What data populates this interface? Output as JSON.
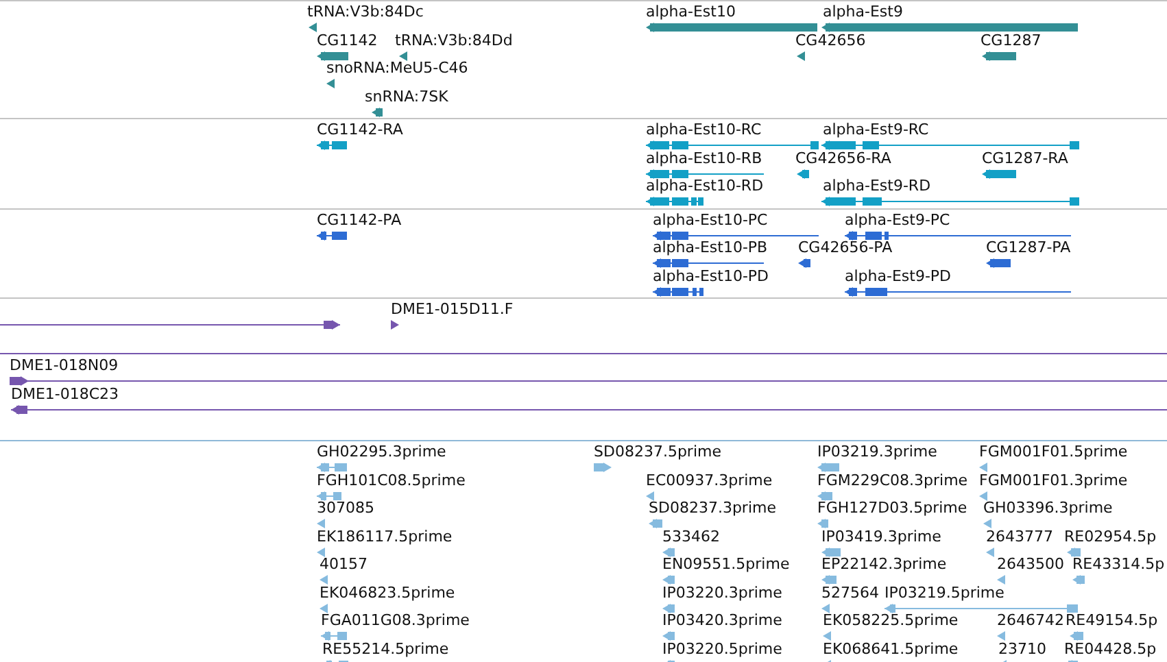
{
  "tracks": [
    {
      "kind": "gene",
      "features": [
        {
          "label": "tRNA:V3b:84Dc",
          "reverse": true
        },
        {
          "label": "CG1142",
          "reverse": true
        },
        {
          "label": "tRNA:V3b:84Dd",
          "reverse": true
        },
        {
          "label": "snoRNA:MeU5-C46",
          "reverse": true
        },
        {
          "label": "snRNA:7SK",
          "reverse": true
        },
        {
          "label": "alpha-Est10",
          "reverse": true
        },
        {
          "label": "alpha-Est9",
          "reverse": true
        },
        {
          "label": "CG42656",
          "reverse": true
        },
        {
          "label": "CG1287",
          "reverse": true
        }
      ]
    },
    {
      "kind": "transcript",
      "features": [
        {
          "label": "CG1142-RA",
          "reverse": true
        },
        {
          "label": "alpha-Est10-RC",
          "reverse": true
        },
        {
          "label": "alpha-Est9-RC",
          "reverse": true
        },
        {
          "label": "alpha-Est10-RB",
          "reverse": true
        },
        {
          "label": "CG42656-RA",
          "reverse": true
        },
        {
          "label": "CG1287-RA",
          "reverse": true
        },
        {
          "label": "alpha-Est10-RD",
          "reverse": true
        },
        {
          "label": "alpha-Est9-RD",
          "reverse": true
        }
      ]
    },
    {
      "kind": "protein",
      "features": [
        {
          "label": "CG1142-PA",
          "reverse": true
        },
        {
          "label": "alpha-Est10-PC",
          "reverse": true
        },
        {
          "label": "alpha-Est9-PC",
          "reverse": true
        },
        {
          "label": "alpha-Est10-PB",
          "reverse": true
        },
        {
          "label": "CG42656-PA",
          "reverse": true
        },
        {
          "label": "CG1287-PA",
          "reverse": true
        },
        {
          "label": "alpha-Est10-PD",
          "reverse": true
        },
        {
          "label": "alpha-Est9-PD",
          "reverse": true
        }
      ]
    },
    {
      "kind": "clone",
      "features": [
        {
          "reverse": false
        },
        {
          "label": "DME1-015D11.F",
          "reverse": false
        },
        {
          "kind": "span"
        },
        {
          "label": "DME1-018N09",
          "reverse": false
        },
        {
          "label": "DME1-018C23",
          "reverse": true
        }
      ]
    },
    {
      "kind": "est",
      "features": [
        {
          "label": "GH02295.3prime",
          "reverse": true
        },
        {
          "label": "SD08237.5prime",
          "reverse": false
        },
        {
          "label": "IP03219.3prime",
          "reverse": true
        },
        {
          "label": "FGM001F01.5prime",
          "reverse": true
        },
        {
          "label": "FGH101C08.5prime",
          "reverse": true
        },
        {
          "label": "EC00937.3prime",
          "reverse": true
        },
        {
          "label": "FGM229C08.3prime",
          "reverse": true
        },
        {
          "label": "FGM001F01.3prime",
          "reverse": true
        },
        {
          "label": "307085",
          "reverse": true
        },
        {
          "label": "SD08237.3prime",
          "reverse": true
        },
        {
          "label": "FGH127D03.5prime",
          "reverse": true
        },
        {
          "label": "GH03396.3prime",
          "reverse": true
        },
        {
          "label": "EK186117.5prime",
          "reverse": true
        },
        {
          "label": "533462",
          "reverse": true
        },
        {
          "label": "IP03419.3prime",
          "reverse": true
        },
        {
          "label": "2643777",
          "reverse": true
        },
        {
          "label": "RE02954.5p",
          "reverse": true
        },
        {
          "label": "40157",
          "reverse": true
        },
        {
          "label": "EN09551.5prime",
          "reverse": true
        },
        {
          "label": "EP22142.3prime",
          "reverse": true
        },
        {
          "label": "2643500",
          "reverse": true
        },
        {
          "label": "RE43314.5p",
          "reverse": true
        },
        {
          "label": "EK046823.5prime",
          "reverse": true
        },
        {
          "label": "IP03220.3prime",
          "reverse": true
        },
        {
          "label": "527564",
          "reverse": true
        },
        {
          "label": "IP03219.5prime",
          "reverse": true
        },
        {
          "label": "FGA011G08.3prime",
          "reverse": true
        },
        {
          "label": "IP03420.3prime",
          "reverse": true
        },
        {
          "label": "EK058225.5prime",
          "reverse": true
        },
        {
          "label": "2646742",
          "reverse": true
        },
        {
          "label": "RE49154.5p",
          "reverse": true
        },
        {
          "label": "RE55214.5prime",
          "reverse": true
        },
        {
          "label": "IP03220.5prime",
          "reverse": true
        },
        {
          "label": "EK068641.5prime",
          "reverse": true
        },
        {
          "label": "23710",
          "reverse": true
        },
        {
          "label": "RE04428.5p",
          "reverse": true
        }
      ]
    }
  ]
}
